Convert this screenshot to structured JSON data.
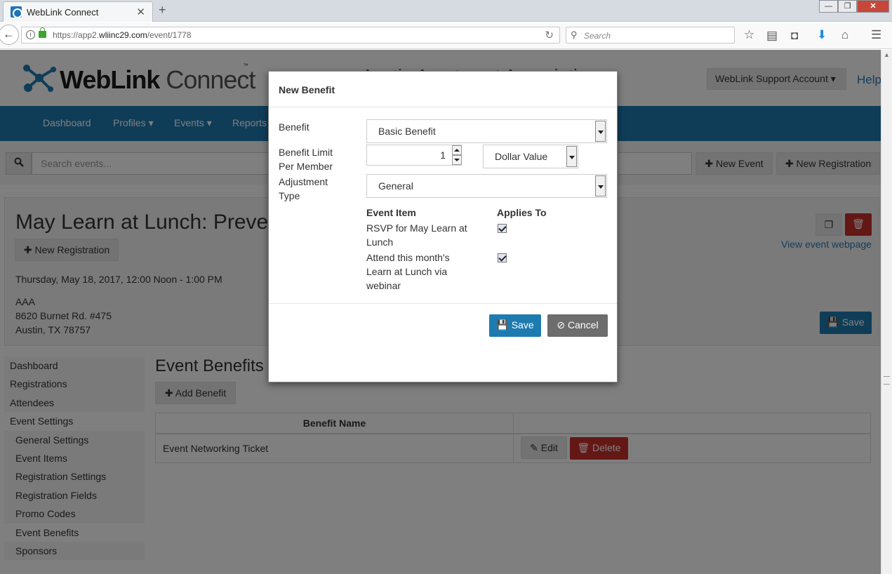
{
  "browser": {
    "tab_title": "WebLink Connect",
    "url_prefix": "https://app2.",
    "url_domain": "wliinc29.com",
    "url_path": "/event/1778",
    "search_placeholder": "Search"
  },
  "header": {
    "logo_bold": "WebLink",
    "logo_light": " Connect",
    "logo_tm": "™",
    "org_name": "Austin Apartment Association",
    "account_label": "WebLink Support Account ▾",
    "help_label": "Help"
  },
  "mainnav": [
    "Dashboard",
    "Profiles ▾",
    "Events ▾",
    "Reports"
  ],
  "search": {
    "placeholder": "Search events...",
    "new_event": "New Event",
    "new_registration": "New Registration"
  },
  "event": {
    "title": "May Learn at Lunch: Preve",
    "new_registration": "New Registration",
    "date": "Thursday, May 18, 2017, 12:00 Noon - 1:00 PM",
    "address": [
      "AAA",
      "8620 Burnet Rd. #475",
      "Austin, TX 78757"
    ],
    "view_webpage": "View event webpage",
    "save": "Save"
  },
  "sidebar": {
    "items": [
      {
        "label": "Dashboard"
      },
      {
        "label": "Registrations"
      },
      {
        "label": "Attendees"
      },
      {
        "label": "Event Settings"
      },
      {
        "label": "General Settings"
      },
      {
        "label": "Event Items"
      },
      {
        "label": "Registration Settings"
      },
      {
        "label": "Registration Fields"
      },
      {
        "label": "Promo Codes"
      },
      {
        "label": "Event Benefits"
      },
      {
        "label": "Sponsors"
      }
    ]
  },
  "benefits": {
    "heading": "Event Benefits",
    "add_button": "Add Benefit",
    "column_header": "Benefit Name",
    "rows": [
      {
        "name": "Event Networking Ticket"
      }
    ],
    "edit": "Edit",
    "delete": "Delete"
  },
  "modal": {
    "title": "New Benefit",
    "benefit_label": "Benefit",
    "benefit_value": "Basic Benefit",
    "limit_label_1": "Benefit Limit",
    "limit_label_2": "Per Member",
    "limit_value": "1",
    "limit_type": "Dollar Value",
    "adjustment_label_1": "Adjustment",
    "adjustment_label_2": "Type",
    "adjustment_value": "General",
    "col_event_item": "Event Item",
    "col_applies_to": "Applies To",
    "items": [
      {
        "lines": [
          "RSVP for May Learn at",
          "Lunch"
        ],
        "checked": true
      },
      {
        "lines": [
          "Attend this month's",
          "Learn at Lunch via",
          "webinar"
        ],
        "checked": true
      }
    ],
    "save": "Save",
    "cancel": "Cancel"
  },
  "colors": {
    "brand_blue": "#1e7bb0",
    "danger_red": "#c9302c",
    "cancel_gray": "#6d6d6d"
  }
}
